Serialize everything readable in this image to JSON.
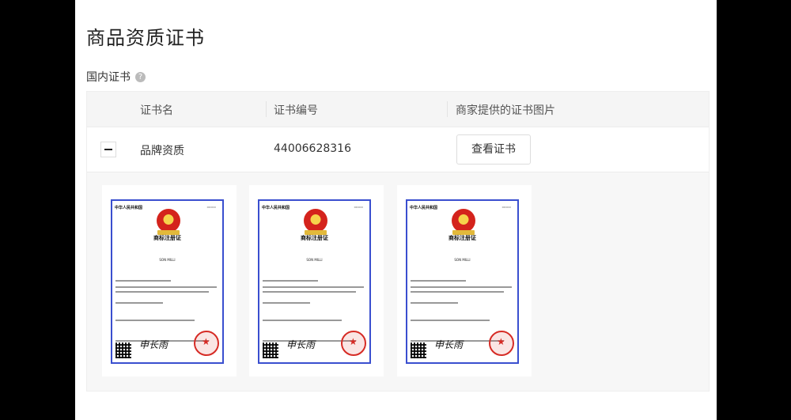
{
  "page": {
    "title": "商品资质证书",
    "section_title": "国内证书",
    "help_icon": "question-circle-icon"
  },
  "table": {
    "headers": [
      "证书名",
      "证书编号",
      "商家提供的证书图片"
    ],
    "row": {
      "name": "品牌资质",
      "number": "44006628316",
      "button_label": "查看证书"
    }
  },
  "certificates": [
    {
      "header": "中华人民共和国",
      "title": "商标注册证",
      "brand": "SON MILLI",
      "signature": "申长雨"
    },
    {
      "header": "中华人民共和国",
      "title": "商标注册证",
      "brand": "SON MILLI",
      "signature": "申长雨"
    },
    {
      "header": "中华人民共和国",
      "title": "商标注册证",
      "brand": "SON MILLI",
      "signature": "申长雨"
    }
  ],
  "colors": {
    "cert_border": "#3a4fcf",
    "seal_red": "#d62b25"
  }
}
